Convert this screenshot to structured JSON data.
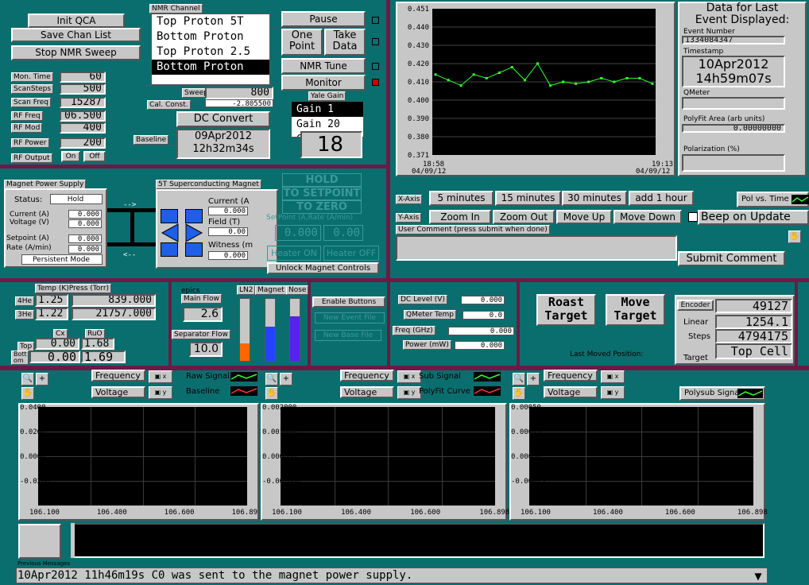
{
  "colors": {
    "bg": "#0b6e6e",
    "divider": "#6b1a46",
    "panel": "#c7c7c7",
    "plot_line": "#33ff33",
    "magnet": "#1f5fe6",
    "ln2": "#ff6600",
    "he": "#2244ff"
  },
  "top_left": {
    "init_qca": "Init QCA",
    "save_chan_list": "Save Chan List",
    "stop_nmr_sweep": "Stop NMR Sweep",
    "params": [
      {
        "label": "Mon. Time",
        "value": "60"
      },
      {
        "label": "ScanSteps",
        "value": "500"
      },
      {
        "label": "Scan Freq",
        "value": "15287"
      },
      {
        "label": "RF Freq",
        "value": "06.500"
      },
      {
        "label": "RF Mod",
        "value": "400"
      },
      {
        "label": "RF Power",
        "value": "200"
      }
    ],
    "rf_output_label": "RF Output",
    "rf_on": "On",
    "rf_off": "Off"
  },
  "nmr": {
    "title": "NMR Channel",
    "channels": [
      "Top Proton 5T",
      "Bottom Proton",
      "Top Proton 2.5",
      "Bottom Proton"
    ],
    "selected_index": 3,
    "pause": "Pause",
    "one_point": "One Point",
    "take_data": "Take Data",
    "nmr_tune": "NMR Tune",
    "monitor": "Monitor",
    "sweeps_label": "Sweeps",
    "sweeps_value": "800",
    "cal_const_label": "Cal. Const.",
    "cal_const_value": "-2.805500",
    "dc_convert": "DC Convert",
    "baseline_label": "Baseline",
    "baseline_date": "09Apr2012",
    "baseline_time": "12h32m34s",
    "yale_gain_label": "Yale Gain",
    "gains": [
      "Gain 1",
      "Gain 20",
      "Gain 50"
    ],
    "gain_display": "18"
  },
  "main_chart": {
    "x_start_date": "04/09/12",
    "x_start_time": "18:58",
    "x_end_date": "04/09/12",
    "x_end_time": "19:13",
    "x_axis_label": "X-Axis",
    "y_axis_label": "Y-Axis",
    "x_buttons": [
      "5 minutes",
      "15 minutes",
      "30 minutes",
      "add 1 hour"
    ],
    "y_buttons": [
      "Zoom In",
      "Zoom Out",
      "Move Up",
      "Move Down"
    ],
    "pol_vs_time": "Pol vs. Time",
    "beep_label": "Beep on Update",
    "user_comment_label": "User Comment (press submit when done)",
    "submit_comment": "Submit Comment"
  },
  "chart_data": {
    "type": "line",
    "title": "",
    "ylim": [
      0.371,
      0.451
    ],
    "yticks": [
      "0.451",
      "0.440",
      "0.430",
      "0.420",
      "0.410",
      "0.400",
      "0.390",
      "0.380",
      "0.371"
    ],
    "x": [
      0,
      1,
      2,
      3,
      4,
      5,
      6,
      7,
      8,
      9,
      10,
      11,
      12,
      13,
      14,
      15,
      16,
      17
    ],
    "values": [
      0.415,
      0.412,
      0.409,
      0.415,
      0.413,
      0.416,
      0.419,
      0.412,
      0.421,
      0.409,
      0.411,
      0.41,
      0.411,
      0.413,
      0.411,
      0.413,
      0.413,
      0.41
    ]
  },
  "last_event": {
    "title_line1": "Data for Last",
    "title_line2": "Event Displayed:",
    "event_number_label": "Event Number",
    "event_number": "1334084347",
    "timestamp_label": "Timestamp",
    "ts_date": "10Apr2012",
    "ts_time": "14h59m07s",
    "qmeter_label": "QMeter",
    "polyfit_label": "PolyFit Area (arb units)",
    "polyfit_value": "0.00000000",
    "polarization_label": "Polarization (%)"
  },
  "magnet_supply": {
    "title": "Magnet Power Supply",
    "status_label": "Status:",
    "status": "Hold",
    "current_label": "Current (A)",
    "current": "0.000",
    "voltage_label": "Voltage (V)",
    "voltage": "0.000",
    "setpoint_label": "Setpoint (A)",
    "setpoint": "0.000",
    "rate_label": "Rate (A/min)",
    "rate": "0.000",
    "mode": "Persistent Mode"
  },
  "sc_magnet": {
    "title": "5T Superconducting Magnet",
    "current_label": "Current (A",
    "current": "0.000",
    "field_label": "Field (T)",
    "field": "0.00",
    "witness_label": "Witness (m",
    "witness": "0.000",
    "hold": "HOLD",
    "to_setpoint": "TO SETPOINT",
    "to_zero": "TO ZERO",
    "setpoint_rate_label": "SetPoint (A,Rate (A/min)",
    "setpoint_val": "0.000",
    "rate_val": "0.00",
    "heater_on": "Heater ON",
    "heater_off": "Heater OFF",
    "unlock": "Unlock Magnet Controls"
  },
  "temps": {
    "header": "Temp (K)Press (Torr)",
    "he4_label": "4He",
    "he4_temp": "1.25",
    "he4_press": "839.000",
    "he3_label": "3He",
    "he3_temp": "1.22",
    "he3_press": "21757.000",
    "cx_label": "Cx",
    "ruo_label": "RuO",
    "top_label": "Top",
    "top_cx": "0.00",
    "top_ruo": "1.68",
    "bottom_label": "Bott om",
    "bot_cx": "0.00",
    "bot_ruo": "1.69"
  },
  "flows": {
    "epics": "epics",
    "main_flow_label": "Main Flow",
    "main_flow": "2.6",
    "sep_flow_label": "Separator Flow",
    "sep_flow": "10.0",
    "ln2": "LN2",
    "magnet": "Magnet",
    "nose": "Nose",
    "levels": {
      "ln2": 0.28,
      "magnet": 0.55,
      "nose": 0.72
    }
  },
  "event_files": {
    "enable": "Enable Buttons",
    "new_event": "New Event File",
    "new_base": "New Base File"
  },
  "levels": {
    "dc_level_label": "DC Level (V)",
    "dc_level": "0.000",
    "qmeter_temp_label": "QMeter Temp",
    "qmeter_temp": "0.0",
    "freq_label": "Freq (GHz)",
    "freq": "0.000",
    "power_label": "Power (mW)",
    "power": "0.000"
  },
  "target": {
    "roast": "Roast Target",
    "move": "Move Target",
    "encoder_label": "Encoder",
    "encoder": "49127",
    "linear_label": "Linear",
    "linear": "1254.1",
    "steps_label": "Steps",
    "steps": "4794175",
    "target_label": "Target",
    "target": "Top_Cell",
    "last_moved": "Last Moved Position:"
  },
  "bottom_plots": [
    {
      "sel1": "Frequency",
      "sel2": "Voltage",
      "leg1": "Raw Signal",
      "leg2": "Baseline",
      "peek": "4b7 ...54.5",
      "yticks": [
        "0.0400",
        "0.0200",
        "0.0000",
        "-0.0200",
        "-0.0400"
      ],
      "xticks": [
        "106.100",
        "106.400",
        "106.600",
        "106.89"
      ]
    },
    {
      "sel1": "Frequency",
      "sel2": "Voltage",
      "leg1": "Sub Signal",
      "leg2": "PolyFit Curve",
      "yticks": [
        "0.002000",
        "0.001000",
        "0.000000",
        "-0.001000",
        "-0.002000"
      ],
      "xticks": [
        "106.100",
        "106.400",
        "106.600",
        "106.898"
      ]
    },
    {
      "sel1": "Frequency",
      "sel2": "Voltage",
      "leg1": "Polysub Signal",
      "yticks": [
        "0.00050",
        "0.00025",
        "0.00000",
        "-0.00025",
        "-0.00050"
      ],
      "xticks": [
        "106.100",
        "106.400",
        "106.600",
        "106.898"
      ]
    }
  ],
  "messages": {
    "prev_label": "Previous Messages",
    "status": "10Apr2012 11h46m19s C0 was sent to the magnet power supply."
  }
}
